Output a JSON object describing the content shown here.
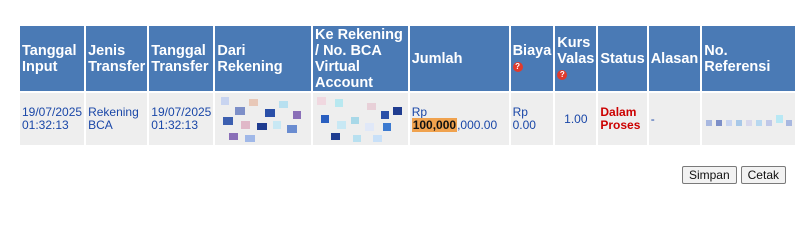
{
  "table": {
    "headers": {
      "input_date": "Tanggal Input",
      "transfer_type": "Jenis Transfer",
      "transfer_date": "Tanggal Transfer",
      "from_account": "Dari Rekening",
      "to_account": "Ke Rekening / No. BCA Virtual Account",
      "amount": "Jumlah",
      "fee": "Biaya",
      "exchange_rate": "Kurs Valas",
      "status": "Status",
      "reason": "Alasan",
      "reference": "No. Referensi"
    },
    "row": {
      "input_date": "19/07/2025",
      "input_time": "01:32:13",
      "transfer_type": "Rekening BCA",
      "transfer_date": "19/07/2025",
      "transfer_time": "01:32:13",
      "amount_prefix": "Rp ",
      "amount_highlight": "100,000",
      "amount_suffix": ",000.00",
      "fee": "Rp 0.00",
      "exchange_rate": "1.00",
      "status": "Dalam Proses",
      "reason": "-"
    }
  },
  "buttons": {
    "save": "Simpan",
    "print": "Cetak"
  },
  "colors": {
    "header_bg": "#4a7ab5",
    "cell_bg": "#eeeeee",
    "cell_text": "#1a47a8",
    "status_text": "#cc0000",
    "highlight": "#f0a24e",
    "help_icon": "#e03a2c"
  },
  "icons": {
    "fee_help": "question-circle-icon",
    "rate_help": "question-circle-icon"
  }
}
